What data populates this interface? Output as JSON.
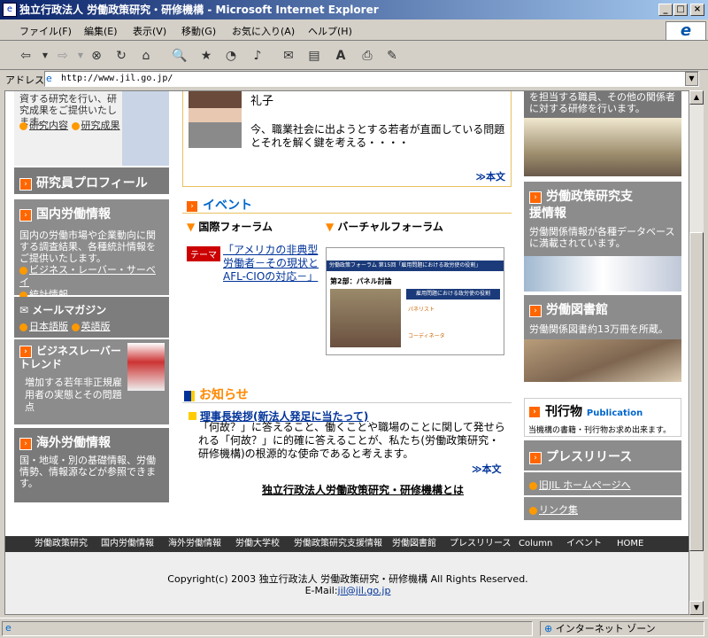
{
  "window": {
    "title": "独立行政法人 労働政策研究・研修機構 - Microsoft Internet Explorer"
  },
  "menu": [
    "ファイル(F)",
    "編集(E)",
    "表示(V)",
    "移動(G)",
    "お気に入り(A)",
    "ヘルプ(H)"
  ],
  "address": {
    "label": "アドレス",
    "url": "http://www.jil.go.jp/"
  },
  "left": {
    "top_text": "資する研究を行い、研究成果をご提供いたします。",
    "top_links": [
      "研究内容",
      "研究成果"
    ],
    "profile": "研究員プロフィール",
    "domestic": {
      "title": "国内労働情報",
      "text": "国内の労働市場や企業動向に関する調査結果、各種統計情報をご提供いたします。",
      "links": [
        "ビジネス・レーバー・サーベイ",
        "統計情報"
      ]
    },
    "mail": {
      "title": "メールマガジン",
      "links": [
        "日本語版",
        "英語版"
      ]
    },
    "blt": {
      "title": "ビジネスレーバートレンド",
      "text": "増加する若年非正規雇用者の実態とその問題点"
    },
    "overseas": {
      "title": "海外労働情報",
      "text": "国・地域・別の基礎情報、労働情勢、情報源などが参照できます。"
    }
  },
  "center": {
    "person": "礼子",
    "interview": "今、職業社会に出ようとする若者が直面している問題とそれを解く鍵を考える・・・・",
    "more1": "≫本文",
    "event": {
      "title": "イベント",
      "col1": "国際フォーラム",
      "col2": "バーチャルフォーラム",
      "tag": "テーマ",
      "link": "「アメリカの非典型労働者－その現状とAFL-CIOの対応－」"
    },
    "forum_img": {
      "head": "労働政策フォーラム 第15回「雇用問題における政労使の役割」",
      "panel": "第2部：パネル討論",
      "box": "雇用問題における政労使の役割",
      "roles": [
        "パネリスト",
        "コーディネータ"
      ]
    },
    "news": {
      "title": "お知らせ",
      "headline": "理事長挨拶(新法人発足に当たって)",
      "body": "「何故？」に答えること、働くことや職場のことに関して発せられる「何故？」に的確に答えることが、私たち(労働政策研究・研修機構)の根源的な使命であると考えます。",
      "more": "≫本文",
      "about": "独立行政法人労働政策研究・研修機構とは"
    }
  },
  "right": {
    "top_text": "を担当する職員、その他の関係者に対する研修を行います。",
    "support": {
      "title": "労働政策研究支援情報",
      "text": "労働関係情報が各種データベースに満載されています。"
    },
    "library": {
      "title": "労働図書館",
      "text": "労働関係図書約13万冊を所蔵。"
    },
    "pub": {
      "title": "刊行物",
      "sub": "Publication",
      "text": "当機構の書籍・刊行物お求め出来ます。"
    },
    "press": "プレスリリース",
    "links": [
      "旧JIL ホームページへ",
      "リンク集"
    ]
  },
  "footer": {
    "nav": [
      "労働政策研究",
      "国内労働情報",
      "海外労働情報",
      "労働大学校",
      "労働政策研究支援情報",
      "労働図書館",
      "プレスリリース",
      "Column",
      "イベント",
      "HOME"
    ],
    "copyright": "Copyright(c) 2003 独立行政法人 労働政策研究・研修機構 All Rights Reserved.",
    "email_label": "E-Mail:",
    "email": "jil@jil.go.jp"
  },
  "status": {
    "zone": "インターネット ゾーン"
  }
}
